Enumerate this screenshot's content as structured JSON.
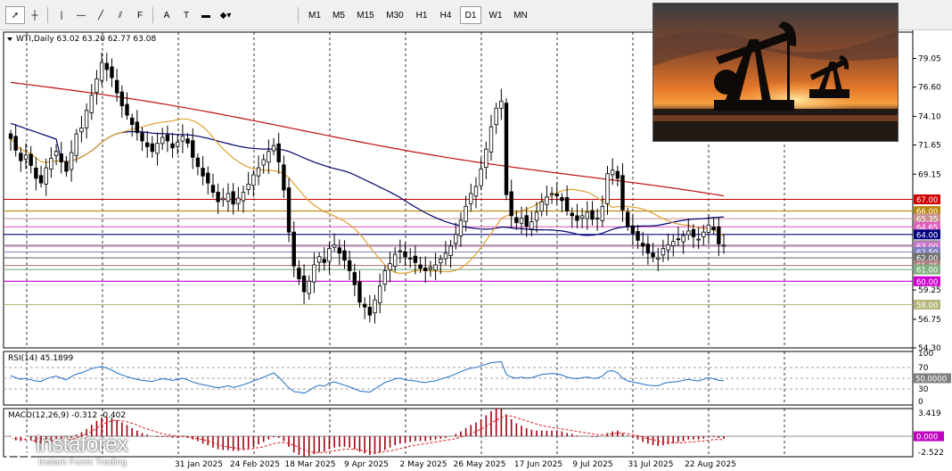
{
  "toolbar": {
    "tools": [
      {
        "name": "cursor-icon",
        "glyph": "➚"
      },
      {
        "name": "crosshair-icon",
        "glyph": "┼"
      },
      {
        "name": "vertical-line-icon",
        "glyph": "|"
      },
      {
        "name": "horizontal-line-icon",
        "glyph": "—"
      },
      {
        "name": "trend-line-icon",
        "glyph": "╱"
      },
      {
        "name": "channel-icon",
        "glyph": "⫽"
      },
      {
        "name": "fibonacci-icon",
        "glyph": "F"
      },
      {
        "name": "text-icon",
        "glyph": "A"
      },
      {
        "name": "text-label-icon",
        "glyph": "T"
      },
      {
        "name": "rectangle-icon",
        "glyph": "▬"
      },
      {
        "name": "shapes-icon",
        "glyph": "◆▾"
      }
    ],
    "timeframes": [
      "M1",
      "M5",
      "M15",
      "M30",
      "H1",
      "H4",
      "D1",
      "W1",
      "MN"
    ],
    "active_timeframe": "D1"
  },
  "chart_data": [
    {
      "type": "candlestick",
      "title": "WTI,Daily  63.02 63.20 62.77 63.08",
      "ohlc": {
        "open": 63.02,
        "high": 63.2,
        "low": 62.77,
        "close": 63.08
      },
      "ylim": [
        54.3,
        81.3
      ],
      "y_ticks": [
        "79.05",
        "76.60",
        "74.10",
        "71.65",
        "69.15",
        "59.25",
        "56.75",
        "54.30"
      ],
      "x_ticks": [
        "31 Jan 2025",
        "24 Feb 2025",
        "18 Mar 2025",
        "9 Apr 2025",
        "2 May 2025",
        "26 May 2025",
        "17 Jun 2025",
        "9 Jul 2025",
        "31 Jul 2025",
        "22 Aug 2025"
      ],
      "levels": [
        {
          "value": 67.0,
          "label": "67.00",
          "color": "#d10000"
        },
        {
          "value": 66.0,
          "label": "66.00",
          "color": "#b8860b"
        },
        {
          "value": 65.35,
          "label": "65.35",
          "color": "#c89090"
        },
        {
          "value": 64.65,
          "label": "64.65",
          "color": "#e060c0"
        },
        {
          "value": 64.0,
          "label": "64.00",
          "color": "#000080"
        },
        {
          "value": 63.08,
          "label": "63.08",
          "color": "#808080"
        },
        {
          "value": 63.0,
          "label": "63.00",
          "color": "#c878c8"
        },
        {
          "value": 62.5,
          "label": "62.50",
          "color": "#8080c0"
        },
        {
          "value": 62.0,
          "label": "62.00",
          "color": "#707070"
        },
        {
          "value": 61.35,
          "label": "61.35",
          "color": "#b08080"
        },
        {
          "value": 61.0,
          "label": "61.00",
          "color": "#80b080"
        },
        {
          "value": 60.0,
          "label": "60.00",
          "color": "#d000d0"
        },
        {
          "value": 58.0,
          "label": "58.00",
          "color": "#b5b57a"
        }
      ],
      "closes": [
        72.2,
        71.2,
        70.3,
        70.8,
        69.9,
        68.8,
        68.4,
        69.7,
        70.5,
        71.1,
        70.2,
        69.4,
        71.0,
        72.6,
        73.1,
        74.6,
        75.9,
        77.3,
        78.7,
        78.1,
        77.4,
        76.1,
        75.0,
        74.2,
        73.4,
        72.7,
        72.0,
        71.5,
        71.1,
        71.8,
        72.3,
        72.0,
        71.4,
        71.9,
        72.4,
        71.8,
        70.6,
        69.8,
        69.0,
        68.4,
        67.6,
        66.8,
        67.1,
        67.5,
        66.6,
        67.1,
        67.6,
        68.3,
        69.1,
        69.7,
        70.4,
        71.1,
        71.6,
        70.2,
        67.8,
        64.2,
        61.3,
        60.2,
        59.1,
        60.0,
        61.4,
        62.1,
        61.6,
        62.8,
        63.1,
        62.4,
        61.8,
        60.9,
        59.7,
        58.2,
        57.8,
        57.1,
        58.4,
        59.6,
        60.9,
        61.5,
        62.3,
        62.6,
        62.1,
        61.9,
        61.6,
        61.1,
        60.9,
        61.2,
        61.4,
        61.9,
        62.4,
        63.0,
        64.0,
        65.2,
        66.4,
        67.5,
        68.1,
        69.6,
        71.3,
        73.2,
        74.8,
        75.4,
        67.4,
        65.6,
        65.0,
        65.4,
        64.7,
        65.1,
        65.9,
        66.8,
        67.2,
        67.5,
        67.3,
        66.9,
        66.0,
        65.6,
        65.2,
        65.6,
        65.9,
        65.3,
        65.4,
        66.4,
        69.2,
        69.5,
        68.8,
        66.1,
        64.7,
        64.1,
        63.5,
        63.0,
        62.4,
        62.1,
        62.0,
        62.8,
        63.1,
        63.4,
        63.6,
        63.9,
        64.3,
        63.8,
        63.6,
        64.2,
        64.8,
        64.4,
        63.2,
        63.08
      ]
    },
    {
      "type": "line",
      "title": "RSI(14) 45.1899",
      "ylim": [
        0,
        100
      ],
      "y_ticks": [
        "100",
        "70",
        "50.0000",
        "30",
        "0"
      ],
      "levels": [
        70,
        50,
        30
      ],
      "values": [
        55,
        51,
        48,
        50,
        47,
        45,
        44,
        49,
        52,
        54,
        50,
        47,
        53,
        58,
        60,
        64,
        68,
        70,
        72,
        69,
        65,
        60,
        56,
        53,
        50,
        48,
        46,
        45,
        44,
        47,
        49,
        48,
        46,
        48,
        50,
        47,
        43,
        40,
        38,
        36,
        34,
        32,
        34,
        36,
        33,
        35,
        38,
        41,
        45,
        48,
        52,
        56,
        60,
        52,
        42,
        32,
        25,
        24,
        22,
        27,
        33,
        37,
        35,
        41,
        43,
        40,
        37,
        34,
        30,
        26,
        25,
        24,
        30,
        36,
        42,
        45,
        49,
        50,
        47,
        46,
        45,
        43,
        42,
        44,
        45,
        48,
        51,
        54,
        58,
        62,
        66,
        69,
        70,
        73,
        76,
        79,
        80,
        81,
        57,
        52,
        50,
        52,
        50,
        51,
        54,
        57,
        58,
        59,
        58,
        56,
        52,
        50,
        49,
        51,
        52,
        50,
        50,
        54,
        63,
        64,
        60,
        50,
        45,
        43,
        41,
        39,
        37,
        36,
        36,
        40,
        42,
        43,
        44,
        46,
        48,
        46,
        45,
        48,
        51,
        49,
        46,
        45.19
      ]
    },
    {
      "type": "bar",
      "title": "MACD(12,26,9) -0.312 -0.402",
      "ylim": [
        -2.522,
        3.419
      ],
      "y_ticks": [
        "3.419",
        "0.000",
        "-2.522"
      ],
      "macd": [
        -0.3,
        -0.5,
        -0.6,
        -0.5,
        -0.6,
        -0.8,
        -0.9,
        -0.7,
        -0.5,
        -0.3,
        -0.3,
        -0.4,
        -0.2,
        0.2,
        0.5,
        0.9,
        1.4,
        1.9,
        2.3,
        2.4,
        2.3,
        2.0,
        1.7,
        1.4,
        1.0,
        0.7,
        0.4,
        0.2,
        0.0,
        -0.1,
        -0.1,
        -0.1,
        -0.2,
        -0.2,
        -0.1,
        -0.2,
        -0.4,
        -0.6,
        -0.9,
        -1.1,
        -1.4,
        -1.6,
        -1.7,
        -1.7,
        -1.8,
        -1.8,
        -1.7,
        -1.5,
        -1.3,
        -1.0,
        -0.7,
        -0.4,
        -0.1,
        -0.2,
        -0.6,
        -1.3,
        -2.0,
        -2.3,
        -2.5,
        -2.4,
        -2.2,
        -2.0,
        -1.9,
        -1.6,
        -1.4,
        -1.3,
        -1.3,
        -1.4,
        -1.6,
        -1.9,
        -2.1,
        -2.3,
        -2.2,
        -2.0,
        -1.7,
        -1.4,
        -1.1,
        -0.9,
        -0.8,
        -0.7,
        -0.6,
        -0.6,
        -0.6,
        -0.5,
        -0.4,
        -0.3,
        -0.2,
        0.0,
        0.3,
        0.6,
        1.0,
        1.4,
        1.7,
        2.1,
        2.6,
        3.1,
        3.4,
        3.4,
        2.7,
        2.1,
        1.6,
        1.3,
        1.0,
        0.8,
        0.7,
        0.7,
        0.7,
        0.7,
        0.7,
        0.6,
        0.4,
        0.3,
        0.1,
        0.0,
        0.0,
        -0.1,
        -0.1,
        0.0,
        0.4,
        0.6,
        0.7,
        0.4,
        0.1,
        -0.2,
        -0.4,
        -0.7,
        -0.9,
        -1.1,
        -1.2,
        -1.1,
        -1.0,
        -0.9,
        -0.7,
        -0.6,
        -0.4,
        -0.4,
        -0.4,
        -0.3,
        -0.1,
        -0.1,
        -0.2,
        -0.312
      ],
      "signal": [
        -0.2,
        -0.3,
        -0.4,
        -0.4,
        -0.5,
        -0.6,
        -0.7,
        -0.7,
        -0.6,
        -0.5,
        -0.5,
        -0.4,
        -0.4,
        -0.2,
        0.0,
        0.3,
        0.6,
        1.0,
        1.4,
        1.7,
        1.9,
        2.0,
        1.9,
        1.8,
        1.6,
        1.4,
        1.1,
        0.9,
        0.7,
        0.5,
        0.3,
        0.2,
        0.1,
        0.0,
        0.0,
        -0.1,
        -0.2,
        -0.3,
        -0.4,
        -0.6,
        -0.8,
        -1.0,
        -1.2,
        -1.3,
        -1.4,
        -1.5,
        -1.6,
        -1.6,
        -1.5,
        -1.4,
        -1.3,
        -1.1,
        -0.9,
        -0.8,
        -0.8,
        -0.9,
        -1.1,
        -1.4,
        -1.7,
        -1.9,
        -2.0,
        -2.0,
        -2.0,
        -1.9,
        -1.8,
        -1.7,
        -1.6,
        -1.6,
        -1.6,
        -1.7,
        -1.8,
        -1.9,
        -2.0,
        -2.0,
        -1.9,
        -1.8,
        -1.7,
        -1.5,
        -1.4,
        -1.2,
        -1.1,
        -1.0,
        -0.9,
        -0.8,
        -0.7,
        -0.6,
        -0.5,
        -0.4,
        -0.3,
        -0.1,
        0.1,
        0.3,
        0.6,
        0.9,
        1.2,
        1.6,
        2.0,
        2.3,
        2.5,
        2.5,
        2.3,
        2.1,
        1.9,
        1.7,
        1.5,
        1.3,
        1.2,
        1.1,
        1.0,
        0.9,
        0.8,
        0.7,
        0.6,
        0.5,
        0.4,
        0.3,
        0.2,
        0.2,
        0.2,
        0.3,
        0.4,
        0.4,
        0.3,
        0.2,
        0.1,
        -0.1,
        -0.3,
        -0.4,
        -0.6,
        -0.7,
        -0.8,
        -0.8,
        -0.8,
        -0.8,
        -0.7,
        -0.7,
        -0.6,
        -0.6,
        -0.5,
        -0.4,
        -0.4,
        -0.402
      ]
    }
  ],
  "colors": {
    "ma_red": "#c01010",
    "ma_navy": "#000070",
    "ma_orange": "#e0a030",
    "rsi_line": "#1e6ec8",
    "macd_hist": "#a00010",
    "macd_signal": "#e02020",
    "grid": "#000000"
  },
  "watermark": {
    "name": "instaforex",
    "tagline": "Instant Forex Trading"
  },
  "photo": {
    "description_icon": "oil-pumpjack-image"
  }
}
